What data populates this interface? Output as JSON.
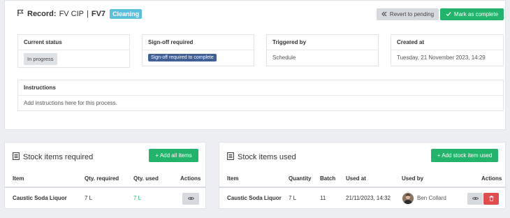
{
  "header": {
    "record_prefix": "Record:",
    "process_name": "FV CIP",
    "separator": "|",
    "vessel": "FV7",
    "type_badge": "Cleaning",
    "revert_label": "Revert to pending",
    "complete_label": "Mark as complete"
  },
  "details": {
    "status": {
      "label": "Current status",
      "value": "In progress"
    },
    "signoff": {
      "label": "Sign-off required",
      "value": "Sign-off required to complete"
    },
    "trigger": {
      "label": "Triggered by",
      "value": "Schedule"
    },
    "created": {
      "label": "Created at",
      "value": "Tuesday, 21 November 2023, 14:29"
    }
  },
  "instructions": {
    "label": "Instructions",
    "text": "Add instructions here for this process."
  },
  "required": {
    "title": "Stock items required",
    "add_label": "+ Add all items",
    "columns": [
      "Item",
      "Qty. required",
      "Qty. used",
      "Actions"
    ],
    "rows": [
      {
        "item": "Caustic Soda Liquor",
        "qty_required": "7 L",
        "qty_used": "7 L"
      }
    ]
  },
  "used": {
    "title": "Stock items used",
    "add_label": "+ Add stock item used",
    "columns": [
      "Item",
      "Quantity",
      "Batch",
      "Used at",
      "Used by",
      "Actions"
    ],
    "rows": [
      {
        "item": "Caustic Soda Liquor",
        "quantity": "7 L",
        "batch": "11",
        "used_at": "21/11/2023, 14:32",
        "used_by": "Ben Collard"
      }
    ]
  },
  "colors": {
    "green": "#21b46a",
    "info": "#5bc0de",
    "signoff": "#3f5f95",
    "danger": "#e24c4c",
    "qty_used_text": "#21b46a"
  },
  "icons": [
    "flag-icon",
    "undo-icon",
    "check-icon",
    "list-icon",
    "eye-icon",
    "trash-icon"
  ]
}
